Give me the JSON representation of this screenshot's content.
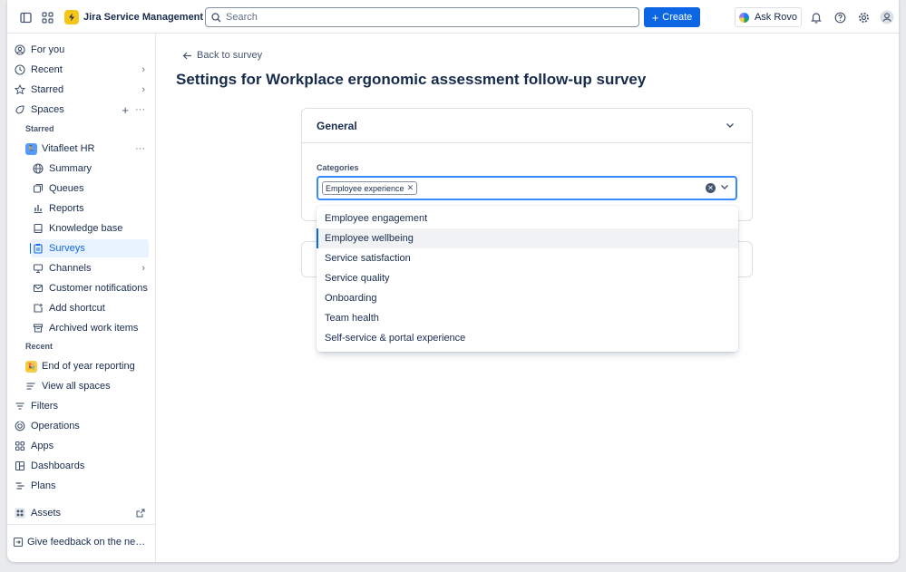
{
  "topbar": {
    "app_name": "Jira Service Management",
    "search_placeholder": "Search",
    "create_label": "Create",
    "ask_rovo_label": "Ask Rovo"
  },
  "sidebar": {
    "for_you": "For you",
    "recent": "Recent",
    "starred": "Starred",
    "spaces": "Spaces",
    "starred_section": "Starred",
    "project_name": "Vitafleet HR",
    "project_items": {
      "summary": "Summary",
      "queues": "Queues",
      "reports": "Reports",
      "knowledge_base": "Knowledge base",
      "surveys": "Surveys",
      "channels": "Channels",
      "customer_notifications": "Customer notifications",
      "add_shortcut": "Add shortcut",
      "archived": "Archived work items"
    },
    "recent_section": "Recent",
    "recent_item": "End of year reporting",
    "view_all_spaces": "View all spaces",
    "filters": "Filters",
    "operations": "Operations",
    "apps": "Apps",
    "dashboards": "Dashboards",
    "plans": "Plans",
    "assets": "Assets",
    "feedback": "Give feedback on the new navigation"
  },
  "main": {
    "back_link": "Back to survey",
    "page_title": "Settings for Workplace ergonomic assessment follow-up survey",
    "general_section": "General",
    "categories_label": "Categories",
    "selected_tag": "Employee experience"
  },
  "dropdown": {
    "options": [
      "Employee engagement",
      "Employee wellbeing",
      "Service satisfaction",
      "Service quality",
      "Onboarding",
      "Team health",
      "Self-service & portal experience"
    ],
    "highlighted_option": "Employee wellbeing"
  },
  "colors": {
    "brand_blue": "#0c66e4",
    "logo_yellow": "#f5c518",
    "focus_border": "#388bff"
  }
}
